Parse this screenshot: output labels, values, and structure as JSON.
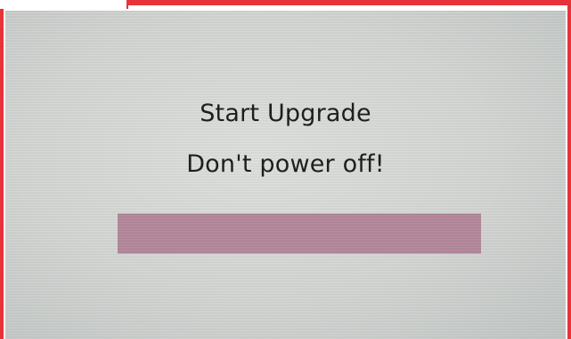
{
  "screen": {
    "line1": "Start Upgrade",
    "line2": "Don't power off!"
  },
  "progress": {
    "fraction": 1.0,
    "fill_color": "#b5889c"
  },
  "colors": {
    "frame": "#e8323a",
    "screen_background": "#d6d9d6",
    "text": "#1e1e1e"
  }
}
